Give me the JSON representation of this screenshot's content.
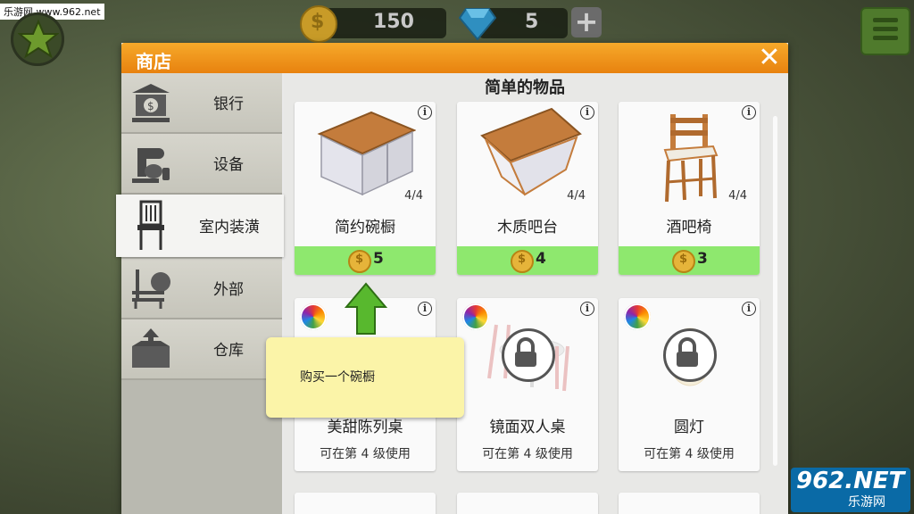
{
  "watermark": "乐游网 www.962.net",
  "hud": {
    "coins": "150",
    "gems": "5",
    "plus_label": "+"
  },
  "shop": {
    "title": "商店",
    "close_label": "✕",
    "sidebar": [
      {
        "label": "银行",
        "icon": "bank-icon"
      },
      {
        "label": "设备",
        "icon": "mixer-icon"
      },
      {
        "label": "室内装潢",
        "icon": "chair-icon",
        "active": true
      },
      {
        "label": "外部",
        "icon": "bench-icon"
      },
      {
        "label": "仓库",
        "icon": "box-icon"
      }
    ],
    "section_title": "简单的物品",
    "items": [
      {
        "name": "简约碗橱",
        "count": "4/4",
        "price": "5"
      },
      {
        "name": "木质吧台",
        "count": "4/4",
        "price": "4"
      },
      {
        "name": "酒吧椅",
        "count": "4/4",
        "price": "3"
      },
      {
        "name": "美甜陈列桌",
        "requirement": "可在第 4 级使用"
      },
      {
        "name": "镜面双人桌",
        "requirement": "可在第 4 级使用",
        "locked": true
      },
      {
        "name": "圆灯",
        "requirement": "可在第 4 级使用",
        "locked": true
      }
    ],
    "tooltip": "购买一个碗橱"
  },
  "logo": {
    "big": "962.NET",
    "small": "乐游网"
  },
  "colors": {
    "header": "#f0981c",
    "price_bar": "#8ee86e",
    "tooltip": "#fbf4a8"
  }
}
